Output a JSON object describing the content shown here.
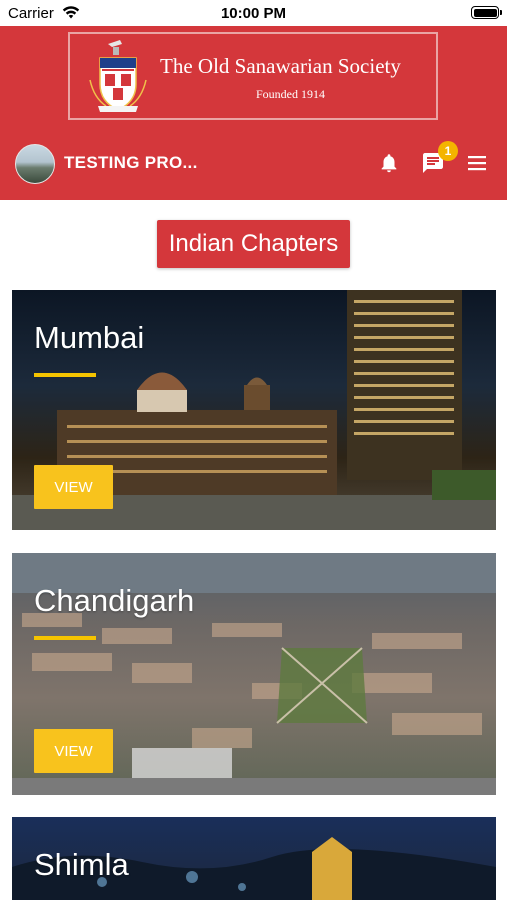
{
  "status_bar": {
    "carrier": "Carrier",
    "time": "10:00 PM"
  },
  "header": {
    "society_name": "The Old Sanawarian Society",
    "founded": "Founded 1914",
    "user_name": "TESTING PRO...",
    "notification_count": "1",
    "icons": [
      "bell-icon",
      "chat-icon",
      "hamburger-menu-icon"
    ]
  },
  "section_button": "Indian Chapters",
  "chapters": [
    {
      "name": "Mumbai",
      "button": "VIEW"
    },
    {
      "name": "Chandigarh",
      "button": "VIEW"
    },
    {
      "name": "Shimla"
    }
  ],
  "colors": {
    "primary_red": "#d4373b",
    "accent_yellow": "#f8c31d"
  }
}
